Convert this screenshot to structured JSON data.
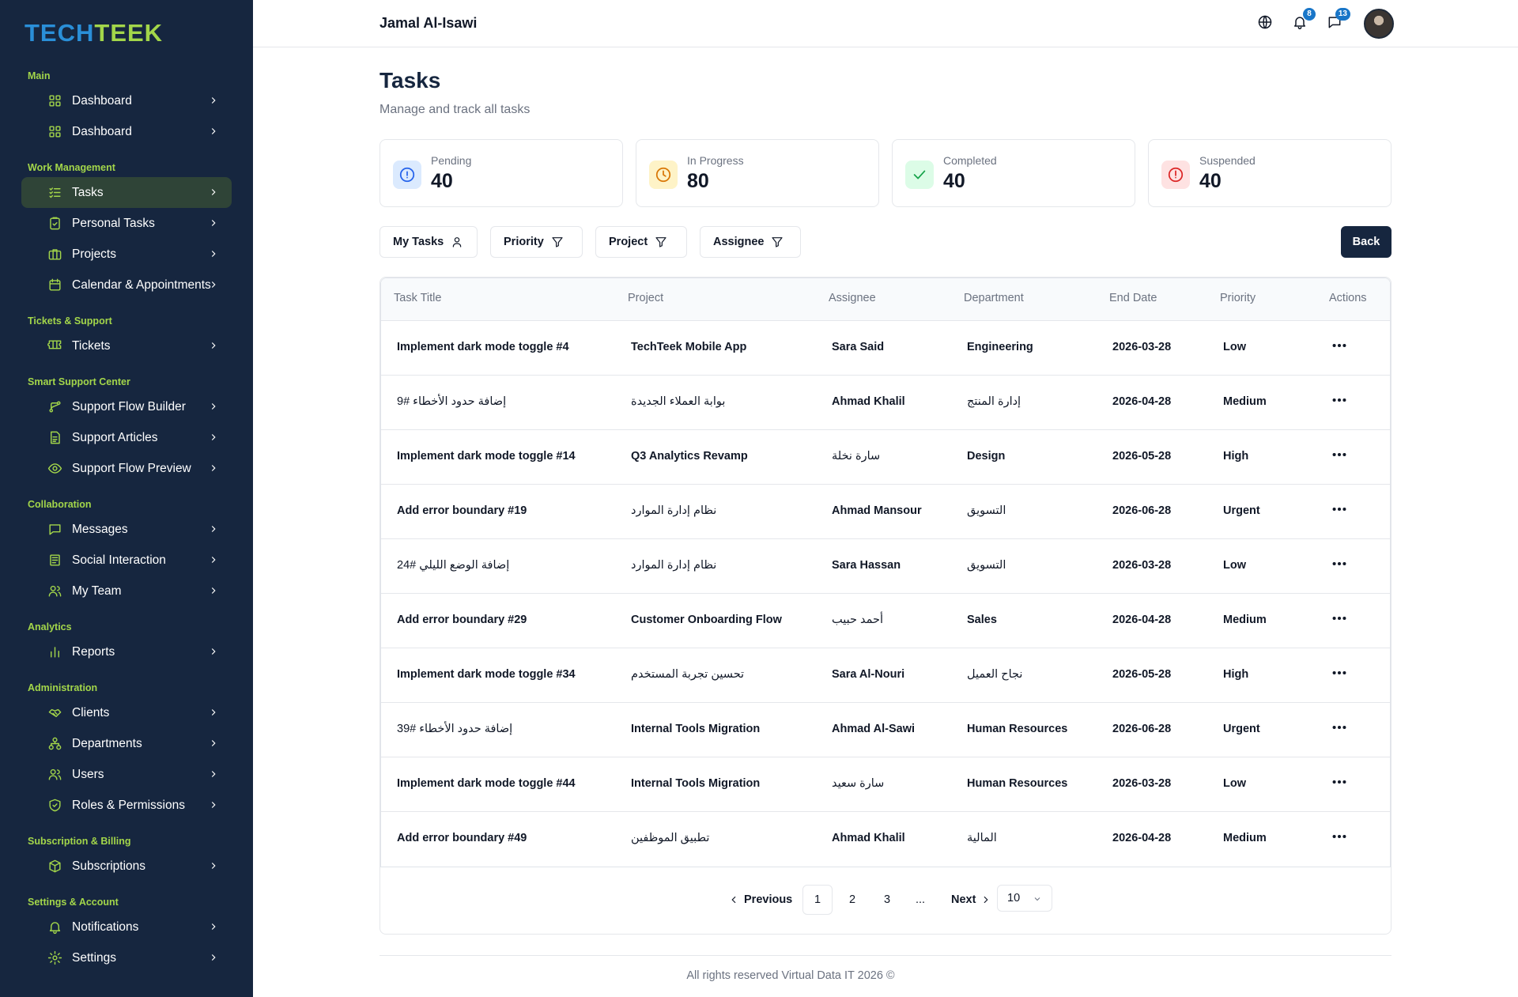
{
  "brand": {
    "logo_part1": "TECH",
    "logo_part2": "TEEK"
  },
  "sidebar": {
    "sections": [
      {
        "title": "Main",
        "items": [
          {
            "label": "Dashboard",
            "icon": "grid-icon"
          },
          {
            "label": "Dashboard",
            "icon": "grid-icon"
          }
        ]
      },
      {
        "title": "Work Management",
        "items": [
          {
            "label": "Tasks",
            "icon": "checklist-icon",
            "active": true
          },
          {
            "label": "Personal Tasks",
            "icon": "clipboard-check-icon"
          },
          {
            "label": "Projects",
            "icon": "briefcase-icon"
          },
          {
            "label": "Calendar & Appointments",
            "icon": "calendar-icon"
          }
        ]
      },
      {
        "title": "Tickets & Support",
        "items": [
          {
            "label": "Tickets",
            "icon": "ticket-icon"
          }
        ]
      },
      {
        "title": "Smart Support Center",
        "items": [
          {
            "label": "Support Flow Builder",
            "icon": "flow-icon"
          },
          {
            "label": "Support Articles",
            "icon": "document-icon"
          },
          {
            "label": "Support Flow Preview",
            "icon": "eye-icon"
          }
        ]
      },
      {
        "title": "Collaboration",
        "items": [
          {
            "label": "Messages",
            "icon": "message-icon"
          },
          {
            "label": "Social Interaction",
            "icon": "newspaper-icon"
          },
          {
            "label": "My Team",
            "icon": "users-icon"
          }
        ]
      },
      {
        "title": "Analytics",
        "items": [
          {
            "label": "Reports",
            "icon": "bar-chart-icon"
          }
        ]
      },
      {
        "title": "Administration",
        "items": [
          {
            "label": "Clients",
            "icon": "handshake-icon"
          },
          {
            "label": "Departments",
            "icon": "org-chart-icon"
          },
          {
            "label": "Users",
            "icon": "users-icon"
          },
          {
            "label": "Roles & Permissions",
            "icon": "shield-check-icon"
          }
        ]
      },
      {
        "title": "Subscription & Billing",
        "items": [
          {
            "label": "Subscriptions",
            "icon": "package-icon"
          }
        ]
      },
      {
        "title": "Settings & Account",
        "items": [
          {
            "label": "Notifications",
            "icon": "bell-icon"
          },
          {
            "label": "Settings",
            "icon": "gear-icon"
          }
        ]
      }
    ]
  },
  "header": {
    "user_name": "Jamal Al-Isawi",
    "notifications_count": "8",
    "messages_count": "13"
  },
  "page": {
    "title": "Tasks",
    "subtitle": "Manage and track all tasks"
  },
  "stats": [
    {
      "label": "Pending",
      "value": "40",
      "icon": "info-circle-icon",
      "color": "#2563eb",
      "bg": "#dbeafe"
    },
    {
      "label": "In Progress",
      "value": "80",
      "icon": "clock-icon",
      "color": "#d97706",
      "bg": "#fef3c7"
    },
    {
      "label": "Completed",
      "value": "40",
      "icon": "check-icon",
      "color": "#16a34a",
      "bg": "#dcfce7"
    },
    {
      "label": "Suspended",
      "value": "40",
      "icon": "alert-circle-icon",
      "color": "#dc2626",
      "bg": "#fee2e2"
    }
  ],
  "filters": {
    "my_tasks": "My Tasks",
    "priority": "Priority",
    "project": "Project",
    "assignee": "Assignee",
    "back": "Back"
  },
  "table": {
    "columns": [
      "Task Title",
      "Project",
      "Assignee",
      "Department",
      "End Date",
      "Priority",
      "Actions"
    ],
    "rows": [
      {
        "title": "Implement dark mode toggle #4",
        "project": "TechTeek Mobile App",
        "assignee": "Sara Said",
        "department": "Engineering",
        "end_date": "2026-03-28",
        "priority": "Low"
      },
      {
        "title": "إضافة حدود الأخطاء #9",
        "project": "بوابة العملاء الجديدة",
        "assignee": "Ahmad Khalil",
        "department": "إدارة المنتج",
        "end_date": "2026-04-28",
        "priority": "Medium"
      },
      {
        "title": "Implement dark mode toggle #14",
        "project": "Q3 Analytics Revamp",
        "assignee": "سارة نخلة",
        "department": "Design",
        "end_date": "2026-05-28",
        "priority": "High"
      },
      {
        "title": "Add error boundary #19",
        "project": "نظام إدارة الموارد",
        "assignee": "Ahmad Mansour",
        "department": "التسويق",
        "end_date": "2026-06-28",
        "priority": "Urgent"
      },
      {
        "title": "إضافة الوضع الليلي #24",
        "project": "نظام إدارة الموارد",
        "assignee": "Sara Hassan",
        "department": "التسويق",
        "end_date": "2026-03-28",
        "priority": "Low"
      },
      {
        "title": "Add error boundary #29",
        "project": "Customer Onboarding Flow",
        "assignee": "أحمد حبيب",
        "department": "Sales",
        "end_date": "2026-04-28",
        "priority": "Medium"
      },
      {
        "title": "Implement dark mode toggle #34",
        "project": "تحسين تجربة المستخدم",
        "assignee": "Sara Al-Nouri",
        "department": "نجاح العميل",
        "end_date": "2026-05-28",
        "priority": "High"
      },
      {
        "title": "إضافة حدود الأخطاء #39",
        "project": "Internal Tools Migration",
        "assignee": "Ahmad Al-Sawi",
        "department": "Human Resources",
        "end_date": "2026-06-28",
        "priority": "Urgent"
      },
      {
        "title": "Implement dark mode toggle #44",
        "project": "Internal Tools Migration",
        "assignee": "سارة سعيد",
        "department": "Human Resources",
        "end_date": "2026-03-28",
        "priority": "Low"
      },
      {
        "title": "Add error boundary #49",
        "project": "تطبيق الموظفين",
        "assignee": "Ahmad Khalil",
        "department": "المالية",
        "end_date": "2026-04-28",
        "priority": "Medium"
      }
    ]
  },
  "pagination": {
    "previous": "Previous",
    "pages": [
      "1",
      "2",
      "3"
    ],
    "ellipsis": "...",
    "next": "Next",
    "page_size": "10"
  },
  "footer": {
    "text": "All rights reserved Virtual Data IT 2026 ©"
  }
}
